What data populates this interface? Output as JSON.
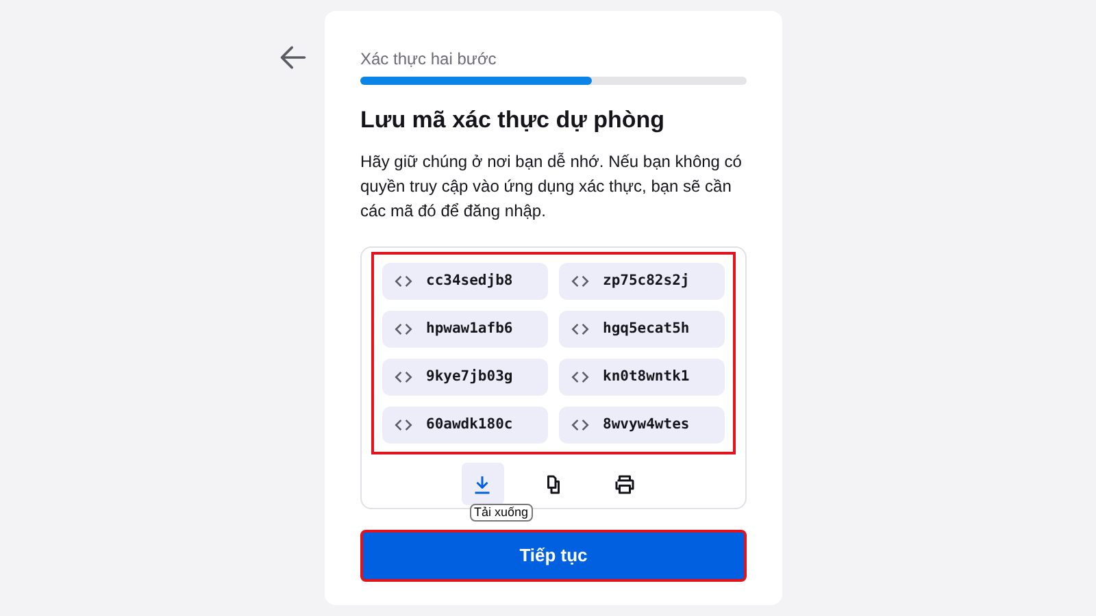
{
  "header": {
    "step_label": "Xác thực hai bước",
    "progress": {
      "level": 0.6
    }
  },
  "title": "Lưu mã xác thực dự phòng",
  "description": "Hãy giữ chúng ở nơi bạn dễ nhớ. Nếu bạn không có quyền truy cập vào ứng dụng xác thực, bạn sẽ cần các mã đó để đăng nhập.",
  "codes_panel": {
    "highlighted": true,
    "codes": [
      "cc34sedjb8",
      "zp75c82s2j",
      "hpwaw1afb6",
      "hgq5ecat5h",
      "9kye7jb03g",
      "kn0t8wntk1",
      "60awdk180c",
      "8wvyw4wtes"
    ],
    "actions": [
      {
        "kind": "download",
        "selected": true
      },
      {
        "kind": "copy",
        "selected": false
      },
      {
        "kind": "print",
        "selected": false
      }
    ],
    "tooltip": "Tải xuống"
  },
  "continue_button": {
    "label": "Tiếp tục",
    "highlighted": true
  }
}
